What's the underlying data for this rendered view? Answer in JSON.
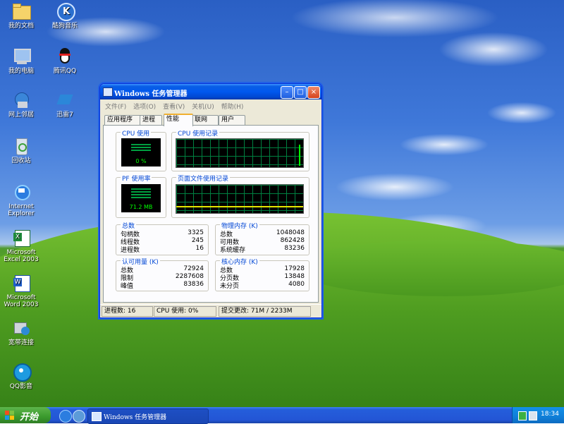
{
  "desktop": {
    "icons": [
      {
        "label": "我的文档"
      },
      {
        "label": "酷狗音乐"
      },
      {
        "label": "我的电脑"
      },
      {
        "label": "腾讯QQ"
      },
      {
        "label": "网上邻居"
      },
      {
        "label": "迅雷7"
      },
      {
        "label": "回收站"
      },
      {
        "label_line1": "Internet",
        "label_line2": "Explorer"
      },
      {
        "label_line1": "Microsoft",
        "label_line2": "Excel 2003"
      },
      {
        "label_line1": "Microsoft",
        "label_line2": "Word 2003"
      },
      {
        "label": "宽带连接"
      },
      {
        "label": "QQ影音"
      }
    ]
  },
  "window": {
    "title": "Windows 任务管理器",
    "menu": [
      "文件(F)",
      "选项(O)",
      "查看(V)",
      "关机(U)",
      "帮助(H)"
    ],
    "tabs": [
      "应用程序",
      "进程",
      "性能",
      "联网",
      "用户"
    ],
    "active_tab": "性能",
    "performance": {
      "cpu_usage_label": "CPU 使用",
      "cpu_usage_value": "0 %",
      "cpu_history_label": "CPU 使用记录",
      "pf_usage_label": "PF 使用率",
      "pf_usage_value": "71.2 MB",
      "pf_history_label": "页面文件使用记录",
      "totals": {
        "title": "总数",
        "rows": [
          {
            "k": "句柄数",
            "v": "3325"
          },
          {
            "k": "线程数",
            "v": "245"
          },
          {
            "k": "进程数",
            "v": "16"
          }
        ]
      },
      "physical": {
        "title": "物理内存 (K)",
        "rows": [
          {
            "k": "总数",
            "v": "1048048"
          },
          {
            "k": "可用数",
            "v": "862428"
          },
          {
            "k": "系统缓存",
            "v": "83236"
          }
        ]
      },
      "commit": {
        "title": "认可用量 (K)",
        "rows": [
          {
            "k": "总数",
            "v": "72924"
          },
          {
            "k": "限制",
            "v": "2287608"
          },
          {
            "k": "峰值",
            "v": "83836"
          }
        ]
      },
      "kernel": {
        "title": "核心内存 (K)",
        "rows": [
          {
            "k": "总数",
            "v": "17928"
          },
          {
            "k": "分页数",
            "v": "13848"
          },
          {
            "k": "未分页",
            "v": "4080"
          }
        ]
      }
    },
    "status": {
      "processes": "进程数: 16",
      "cpu": "CPU 使用: 0%",
      "commit": "提交更改: 71M / 2233M"
    }
  },
  "taskbar": {
    "start_label": "开始",
    "task_button_label": "Windows 任务管理器",
    "clock": "18:34"
  }
}
